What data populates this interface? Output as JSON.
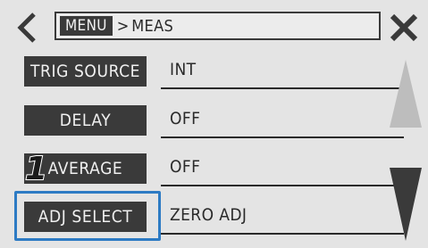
{
  "header": {
    "menu_label": "MENU",
    "separator": ">",
    "current": "MEAS"
  },
  "rows": [
    {
      "label": "TRIG SOURCE",
      "value": "INT"
    },
    {
      "label": "DELAY",
      "value": "OFF"
    },
    {
      "label": "AVERAGE",
      "value": "OFF"
    },
    {
      "label": "ADJ SELECT",
      "value": "ZERO ADJ"
    }
  ],
  "annotation": {
    "step_number": "1"
  },
  "colors": {
    "background": "#e4e4e4",
    "button": "#3a3a3a",
    "highlight": "#2d7bc4",
    "scroll_up_disabled": "#bdbdbd",
    "scroll_down_active": "#3a3a3a"
  },
  "icons": {
    "back": "chevron-left-icon",
    "close": "close-icon",
    "scroll_up": "triangle-up-icon",
    "scroll_down": "triangle-down-icon"
  }
}
